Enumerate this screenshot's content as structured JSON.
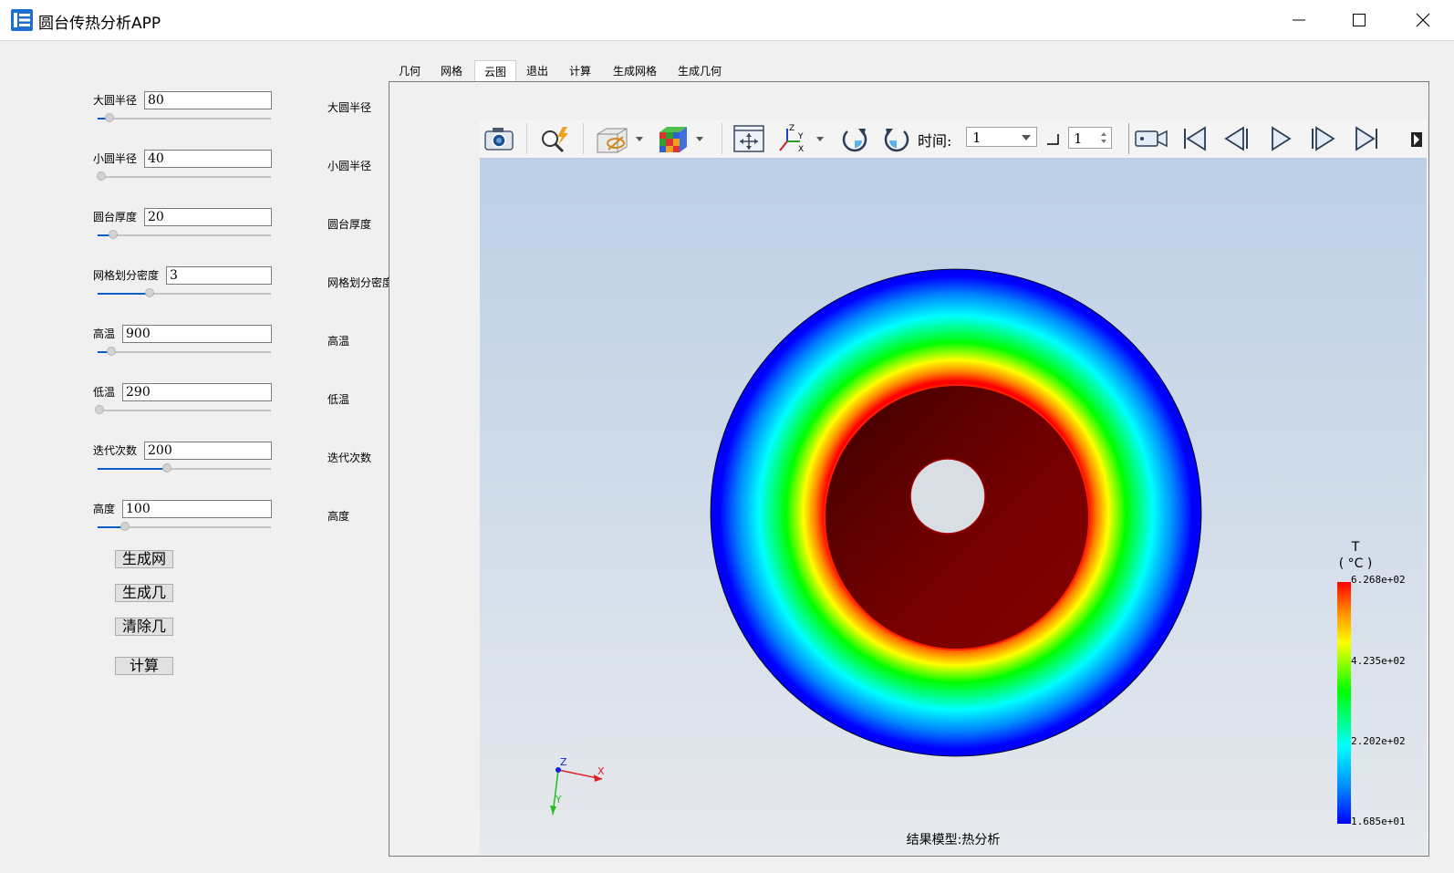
{
  "window": {
    "title": "圆台传热分析APP",
    "icon": "app-icon",
    "controls": [
      "minimize-icon",
      "maximize-icon",
      "close-icon"
    ]
  },
  "params": [
    {
      "label": "大圆半径",
      "value": "80",
      "slider_fraction": 0.07,
      "right_label": "大圆半径"
    },
    {
      "label": "小圆半径",
      "value": "40",
      "slider_fraction": 0.02,
      "right_label": "小圆半径"
    },
    {
      "label": "圆台厚度",
      "value": "20",
      "slider_fraction": 0.09,
      "right_label": "圆台厚度"
    },
    {
      "label": "网格划分密度",
      "value": "3",
      "slider_fraction": 0.3,
      "right_label": "网格划分密度"
    },
    {
      "label": "高温",
      "value": "900",
      "slider_fraction": 0.08,
      "right_label": "高温"
    },
    {
      "label": "低温",
      "value": "290",
      "slider_fraction": 0.01,
      "right_label": "低温"
    },
    {
      "label": "迭代次数",
      "value": "200",
      "slider_fraction": 0.4,
      "right_label": "迭代次数"
    },
    {
      "label": "高度",
      "value": "100",
      "slider_fraction": 0.16,
      "right_label": "高度"
    }
  ],
  "buttons": {
    "gen_mesh": "生成网格",
    "gen_geom": "生成几何",
    "clear_geom": "清除几何",
    "calc": "计算"
  },
  "tabs": [
    {
      "label": "几何",
      "active": false
    },
    {
      "label": "网格",
      "active": false
    },
    {
      "label": "云图",
      "active": true
    },
    {
      "label": "退出",
      "active": false
    },
    {
      "label": "计算",
      "active": false
    },
    {
      "label": "生成网格",
      "active": false
    },
    {
      "label": "生成几何",
      "active": false
    }
  ],
  "toolbar": {
    "time_label": "时间:",
    "time_value": "1",
    "step_value": "1",
    "icons": [
      "camera-icon",
      "probe-icon",
      "visibility-icon",
      "cube-mesh-icon",
      "fit-view-icon",
      "axes-icon",
      "rotate-cw-icon",
      "rotate-ccw-icon",
      "record-icon",
      "first-frame-icon",
      "prev-frame-icon",
      "play-icon",
      "next-frame-icon",
      "last-frame-icon"
    ]
  },
  "viewport": {
    "model_label": "结果模型:热分析",
    "triad": {
      "z": "Z",
      "x": "X",
      "y": "Y"
    },
    "legend": {
      "title_line1": "T",
      "title_line2": "( °C )",
      "ticks": [
        "6.268e+02",
        "4.235e+02",
        "2.202e+02",
        "1.685e+01"
      ],
      "colors": [
        "#ff0000",
        "#ffff00",
        "#00ff00",
        "#00ffff",
        "#0000ff"
      ]
    }
  }
}
